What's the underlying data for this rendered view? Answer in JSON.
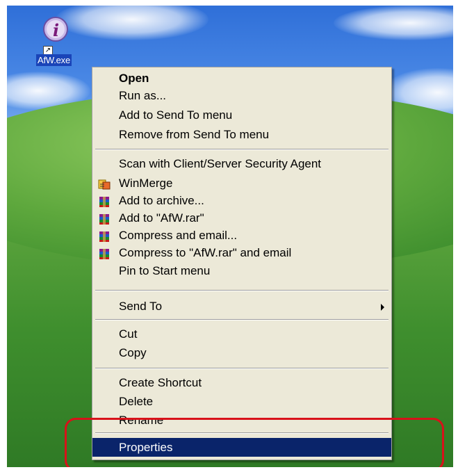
{
  "desktop_icon": {
    "label": "AfW.exe",
    "icon": "info-icon",
    "overlay": "shortcut-arrow-icon"
  },
  "context_menu": {
    "items": [
      {
        "label": "Open",
        "bold": true
      },
      {
        "label": "Run as..."
      },
      {
        "label": "Add to Send To menu"
      },
      {
        "label": "Remove from Send To menu"
      },
      {
        "label": "Scan with Client/Server Security Agent"
      },
      {
        "label": "WinMerge",
        "icon": "winmerge-icon"
      },
      {
        "label": "Add to archive...",
        "icon": "winrar-icon"
      },
      {
        "label": "Add to \"AfW.rar\"",
        "icon": "winrar-icon"
      },
      {
        "label": "Compress and email...",
        "icon": "winrar-icon"
      },
      {
        "label": "Compress to \"AfW.rar\" and email",
        "icon": "winrar-icon"
      },
      {
        "label": "Pin to Start menu"
      },
      {
        "label": "Send To",
        "submenu": true
      },
      {
        "label": "Cut"
      },
      {
        "label": "Copy"
      },
      {
        "label": "Create Shortcut"
      },
      {
        "label": "Delete"
      },
      {
        "label": "Rename"
      },
      {
        "label": "Properties",
        "selected": true
      }
    ]
  },
  "colors": {
    "menu_bg": "#ece9d8",
    "selection": "#0a246a",
    "highlight_ring": "#d8121a",
    "icon_label_bg": "#1a44b8"
  }
}
